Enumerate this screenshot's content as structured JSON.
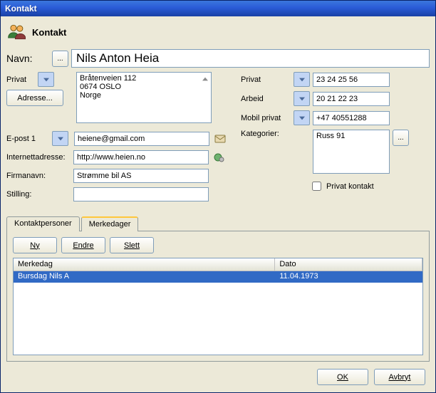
{
  "window": {
    "title": "Kontakt"
  },
  "header": {
    "title": "Kontakt"
  },
  "name": {
    "label": "Navn:",
    "value": "Nils Anton Heia"
  },
  "left": {
    "privat_label": "Privat",
    "adresse_btn": "Adresse...",
    "address_text": "Bråtenveien 112\n0674 OSLO\nNorge",
    "epost1_label": "E-post 1",
    "epost1_value": "heiene@gmail.com",
    "internett_label": "Internettadresse:",
    "internett_value": "http://www.heien.no",
    "firma_label": "Firmanavn:",
    "firma_value": "Strømme bil AS",
    "stilling_label": "Stilling:",
    "stilling_value": ""
  },
  "right": {
    "privat_label": "Privat",
    "privat_value": "23 24 25 56",
    "arbeid_label": "Arbeid",
    "arbeid_value": "20 21 22 23",
    "mobil_label": "Mobil privat",
    "mobil_value": "+47 40551288",
    "kategorier_label": "Kategorier:",
    "kategorier_value": "Russ 91",
    "privat_kontakt_label": "Privat kontakt"
  },
  "tabs": {
    "kontaktpersoner": "Kontaktpersoner",
    "merkedager": "Merkedager"
  },
  "tabpanel": {
    "ny": "Ny",
    "endre": "Endre",
    "slett": "Slett",
    "col1": "Merkedag",
    "col2": "Dato",
    "rows": [
      {
        "merkedag": "Bursdag Nils A",
        "dato": "11.04.1973"
      }
    ]
  },
  "footer": {
    "ok": "OK",
    "avbryt": "Avbryt"
  }
}
